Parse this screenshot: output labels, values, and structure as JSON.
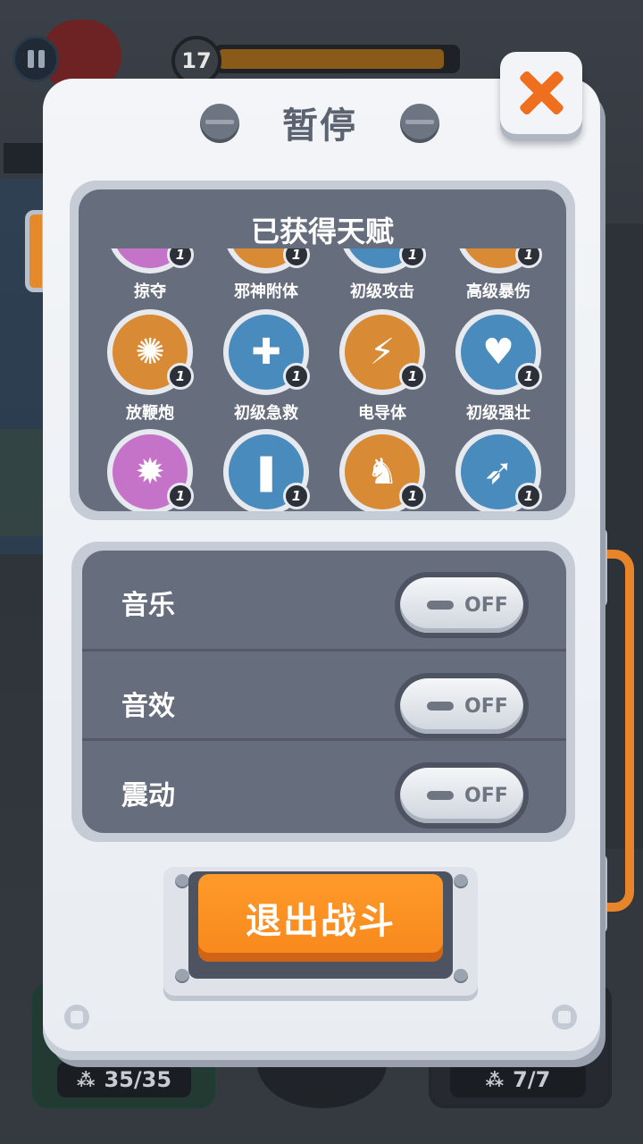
{
  "hud": {
    "level": "17",
    "progress_fraction": 0.95,
    "ammo_left": "35/35",
    "ammo_right": "7/7"
  },
  "dialog": {
    "title": "暂停",
    "talents_title": "已获得天赋",
    "talent_rows": [
      [
        {
          "label": "掠夺",
          "count": "1",
          "color": "#c573c9",
          "icon": "loot-icon"
        },
        {
          "label": "邪神附体",
          "count": "1",
          "color": "#d98a35",
          "icon": "evil-god-icon"
        },
        {
          "label": "初级攻击",
          "count": "1",
          "color": "#4a8bbd",
          "icon": "attack-icon"
        },
        {
          "label": "高级暴伤",
          "count": "1",
          "color": "#d98a35",
          "icon": "crit-damage-icon"
        }
      ],
      [
        {
          "label": "放鞭炮",
          "count": "1",
          "color": "#d98a35",
          "icon": "firecracker-icon"
        },
        {
          "label": "初级急救",
          "count": "1",
          "color": "#4a8bbd",
          "icon": "first-aid-kit-icon"
        },
        {
          "label": "电导体",
          "count": "1",
          "color": "#d98a35",
          "icon": "lightning-icon"
        },
        {
          "label": "初级强壮",
          "count": "1",
          "color": "#4a8bbd",
          "icon": "heart-up-icon"
        }
      ],
      [
        {
          "label": "",
          "count": "1",
          "color": "#c573c9",
          "icon": "explosion-icon"
        },
        {
          "label": "",
          "count": "1",
          "color": "#4a8bbd",
          "icon": "bullets-icon"
        },
        {
          "label": "",
          "count": "1",
          "color": "#d98a35",
          "icon": "guardian-lion-icon"
        },
        {
          "label": "",
          "count": "1",
          "color": "#4a8bbd",
          "icon": "rocket-icon"
        }
      ]
    ],
    "settings": [
      {
        "label": "音乐",
        "state": "OFF"
      },
      {
        "label": "音效",
        "state": "OFF"
      },
      {
        "label": "震动",
        "state": "OFF"
      }
    ],
    "exit_label": "退出战斗"
  },
  "colors": {
    "accent_orange": "#f7871c",
    "panel": "#eef1f5",
    "inner_panel": "#666d7c"
  }
}
